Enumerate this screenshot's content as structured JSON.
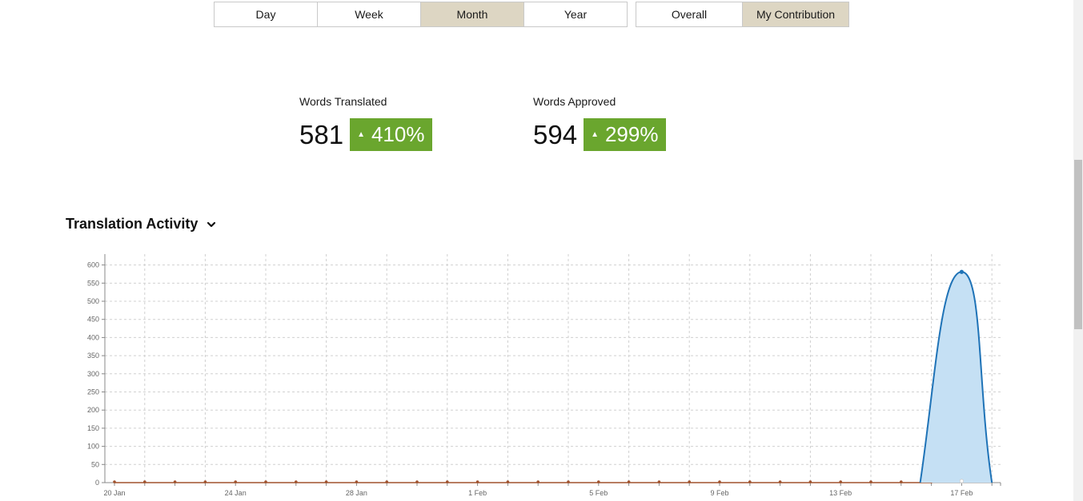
{
  "period_tabs": [
    {
      "label": "Day",
      "active": false
    },
    {
      "label": "Week",
      "active": false
    },
    {
      "label": "Month",
      "active": true
    },
    {
      "label": "Year",
      "active": false
    }
  ],
  "scope_tabs": [
    {
      "label": "Overall",
      "active": false
    },
    {
      "label": "My Contribution",
      "active": true
    }
  ],
  "stats": {
    "translated": {
      "label": "Words Translated",
      "value": "581",
      "change": "410%",
      "trend": "up"
    },
    "approved": {
      "label": "Words Approved",
      "value": "594",
      "change": "299%",
      "trend": "up"
    }
  },
  "section": {
    "title": "Translation Activity",
    "toggle_icon": "chevron-down-icon"
  },
  "colors": {
    "active_tab": "#ddd6c3",
    "badge_green": "#6aa62e",
    "series_line": "#1f73b7",
    "series_fill": "#c5e0f4",
    "baseline": "#a0522d"
  },
  "chart_data": {
    "type": "area",
    "start_date": "20 Jan",
    "x_tick_labels": [
      "20 Jan",
      "24 Jan",
      "28 Jan",
      "1 Feb",
      "5 Feb",
      "9 Feb",
      "13 Feb",
      "17 Feb"
    ],
    "y_ticks": [
      0,
      50,
      100,
      150,
      200,
      250,
      300,
      350,
      400,
      450,
      500,
      550,
      600
    ],
    "ylim": [
      0,
      630
    ],
    "grid": true,
    "series": [
      {
        "values": [
          0,
          0,
          0,
          0,
          0,
          0,
          0,
          0,
          0,
          0,
          0,
          0,
          0,
          0,
          0,
          0,
          0,
          0,
          0,
          0,
          0,
          0,
          0,
          0,
          0,
          0,
          0,
          0,
          581,
          0
        ]
      }
    ]
  }
}
